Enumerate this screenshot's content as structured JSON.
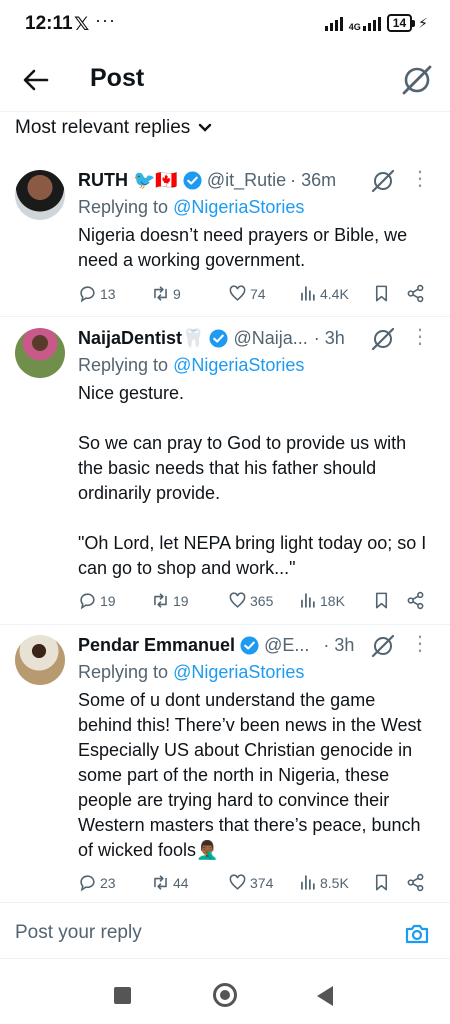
{
  "status_bar": {
    "time": "12:11",
    "x_logo": "𝕏",
    "dots": "···",
    "network": "4G",
    "battery": "14"
  },
  "header": {
    "title": "Post"
  },
  "sort": {
    "label": "Most relevant replies"
  },
  "tweets": [
    {
      "name": "RUTH 🐦🇨🇦",
      "handle": "@it_Rutie",
      "time": "· 36m",
      "replying_prefix": "Replying to ",
      "replying_to": "@NigeriaStories",
      "body": "Nigeria doesn’t need prayers or Bible, we need a working government.",
      "replies": "13",
      "reposts": "9",
      "likes": "74",
      "views": "4.4K"
    },
    {
      "name": "NaijaDentist🦷",
      "handle": "@Naija...",
      "time": "· 3h",
      "replying_prefix": "Replying to ",
      "replying_to": "@NigeriaStories",
      "body": "Nice gesture.\n\nSo we can pray to God to provide us with the basic needs that his father should ordinarily provide.\n\n\"Oh Lord, let NEPA bring light today oo; so I can go to shop and work...\"",
      "replies": "19",
      "reposts": "19",
      "likes": "365",
      "views": "18K"
    },
    {
      "name": "Pendar Emmanuel",
      "handle": "@E...",
      "time": "· 3h",
      "replying_prefix": "Replying to ",
      "replying_to": "@NigeriaStories",
      "body": "Some of u dont understand the game behind this! There’v been news in the West Especially US about Christian genocide in some part of the north in Nigeria, these people are trying hard to convince their Western masters that there’s peace, bunch of wicked fools🤦🏾‍♂️",
      "replies": "23",
      "reposts": "44",
      "likes": "374",
      "views": "8.5K"
    }
  ],
  "reply_bar": {
    "placeholder": "Post your reply"
  },
  "colors": {
    "accent": "#1d9bf0",
    "muted": "#536471",
    "text": "#0f1419"
  }
}
